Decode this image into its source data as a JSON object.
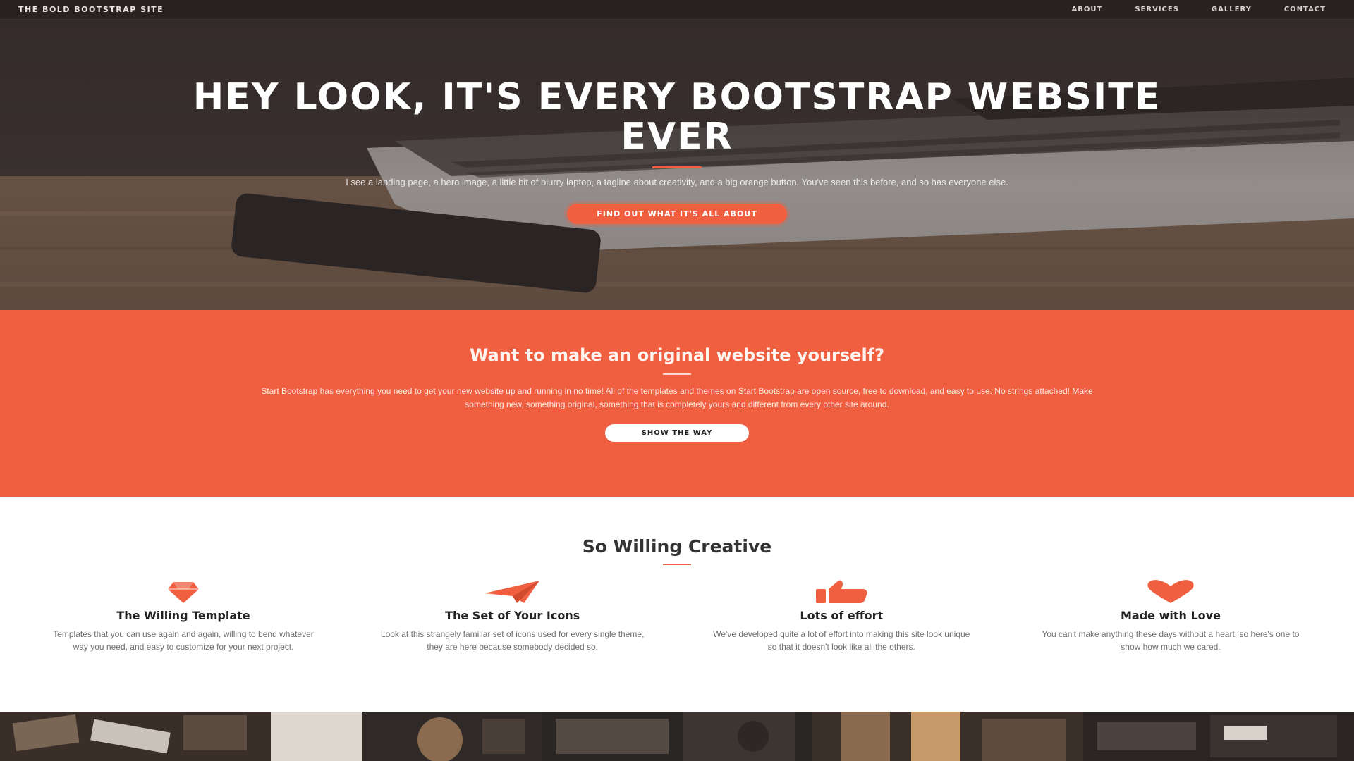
{
  "navbar": {
    "brand": "THE BOLD BOOTSTRAP SITE",
    "links": [
      "ABOUT",
      "SERVICES",
      "GALLERY",
      "CONTACT"
    ]
  },
  "hero": {
    "title": "HEY LOOK, IT'S EVERY BOOTSTRAP WEBSITE EVER",
    "subtitle": "I see a landing page, a hero image, a little bit of blurry laptop, a tagline about creativity, and a big orange button. You've seen this before, and so has everyone else.",
    "button_label": "FIND OUT WHAT IT'S ALL ABOUT"
  },
  "about": {
    "title": "Want to make an original website yourself?",
    "text": "Start Bootstrap has everything you need to get your new website up and running in no time! All of the templates and themes on Start Bootstrap are open source, free to download, and easy to use. No strings attached! Make something new, something original, something that is completely yours and different from every other site around.",
    "button_label": "SHOW THE WAY"
  },
  "services": {
    "title": "So Willing Creative",
    "items": [
      {
        "icon": "diamond-icon",
        "title": "The Willing Template",
        "text": "Templates that you can use again and again, willing to bend whatever way you need, and easy to customize for your next project."
      },
      {
        "icon": "paper-plane-icon",
        "title": "The Set of Your Icons",
        "text": "Look at this strangely familiar set of icons used for every single theme, they are here because somebody decided so."
      },
      {
        "icon": "thumbs-up-icon",
        "title": "Lots of effort",
        "text": "We've developed quite a lot of effort into making this site look unique so that it doesn't look like all the others."
      },
      {
        "icon": "heart-icon",
        "title": "Made with Love",
        "text": "You can't make anything these days without a heart, so here's one to show how much we cared."
      }
    ]
  },
  "colors": {
    "accent": "#f05f40",
    "navbar_bg": "#282221",
    "services_icon": "#f05f40"
  }
}
